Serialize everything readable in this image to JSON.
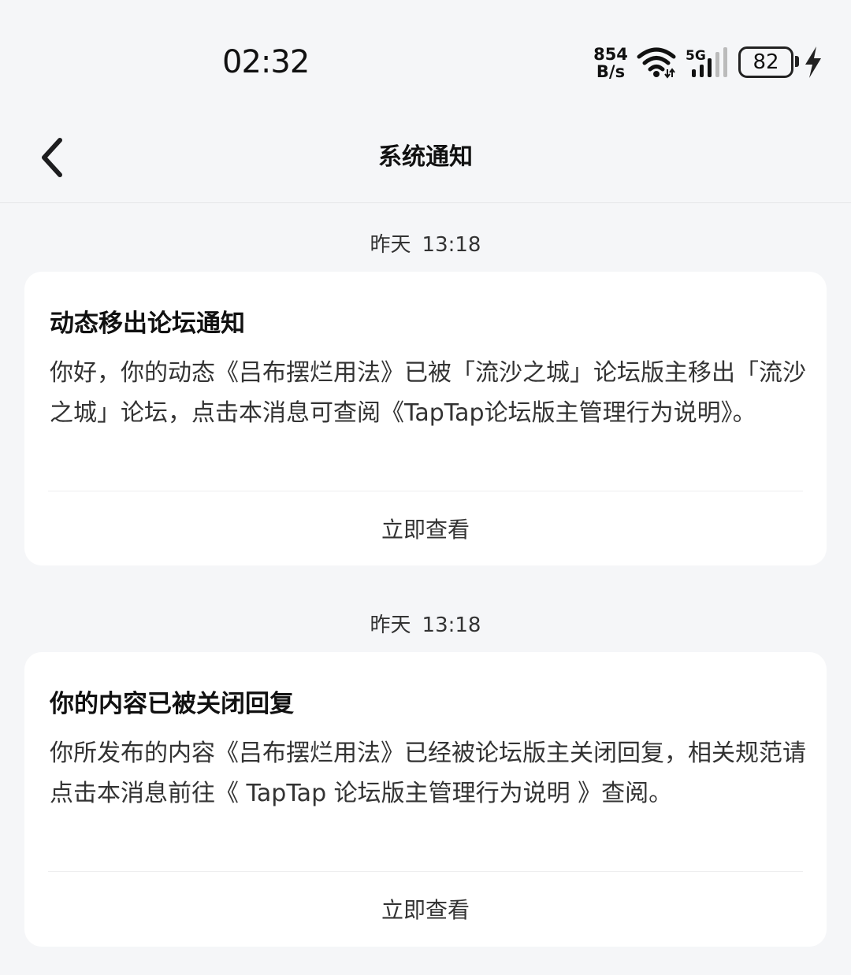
{
  "status_bar": {
    "time": "02:32",
    "net_speed_value": "854",
    "net_speed_unit": "B/s",
    "network_type": "5G",
    "battery_level": "82"
  },
  "header": {
    "title": "系统通知",
    "back_icon": "chevron-left-icon"
  },
  "messages": [
    {
      "date": "昨天",
      "time": "13:18",
      "title": "动态移出论坛通知",
      "body": "你好，你的动态《吕布摆烂用法》已被「流沙之城」论坛版主移出「流沙之城」论坛，点击本消息可查阅《TapTap论坛版主管理行为说明》。",
      "action": "立即查看"
    },
    {
      "date": "昨天",
      "time": "13:18",
      "title": "你的内容已被关闭回复",
      "body": "你所发布的内容《吕布摆烂用法》已经被论坛版主关闭回复，相关规范请点击本消息前往《 TapTap 论坛版主管理行为说明 》查阅。",
      "action": "立即查看"
    }
  ]
}
